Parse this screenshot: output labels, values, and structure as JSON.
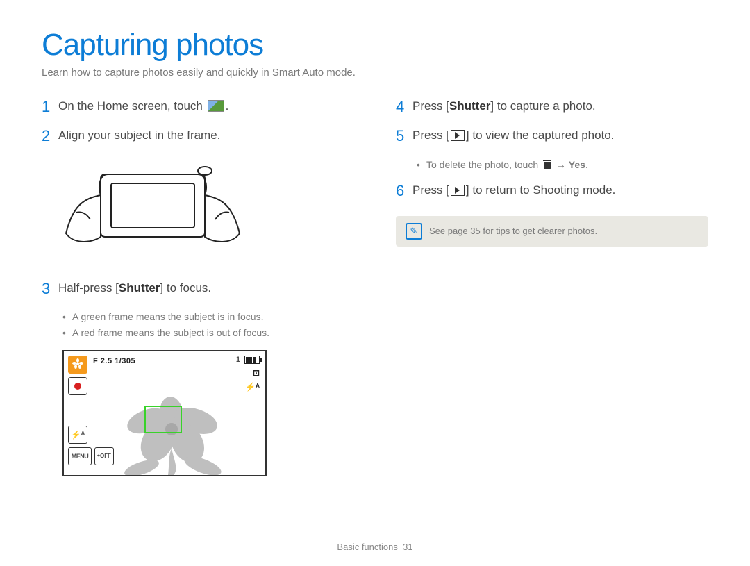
{
  "title": "Capturing photos",
  "subtitle": "Learn how to capture photos easily and quickly in Smart Auto mode.",
  "left": {
    "step1": {
      "num": "1",
      "text_a": "On the Home screen, touch ",
      "text_b": "."
    },
    "step2": {
      "num": "2",
      "text": "Align your subject in the frame."
    },
    "step3": {
      "num": "3",
      "text_a": "Half-press [",
      "bold": "Shutter",
      "text_b": "] to focus.",
      "bullets": [
        "A green frame means the subject is in focus.",
        "A red frame means the subject is out of focus."
      ]
    },
    "lcd": {
      "exposure": "F 2.5 1/305",
      "count": "1",
      "menu_label": "MENU",
      "off_label": "OFF",
      "flash_label": "⚡ᴬ",
      "flash2_label": "⚡ᴬ"
    }
  },
  "right": {
    "step4": {
      "num": "4",
      "text_a": "Press [",
      "bold": "Shutter",
      "text_b": "] to capture a photo."
    },
    "step5": {
      "num": "5",
      "text_a": "Press [",
      "text_b": "] to view the captured photo.",
      "bullet_a": "To delete the photo, touch ",
      "bullet_arrow": " → ",
      "bullet_bold": "Yes",
      "bullet_c": "."
    },
    "step6": {
      "num": "6",
      "text_a": "Press [",
      "text_b": "] to return to Shooting mode."
    },
    "tip": "See page 35 for tips to get clearer photos."
  },
  "footer": {
    "section": "Basic functions",
    "page": "31"
  }
}
